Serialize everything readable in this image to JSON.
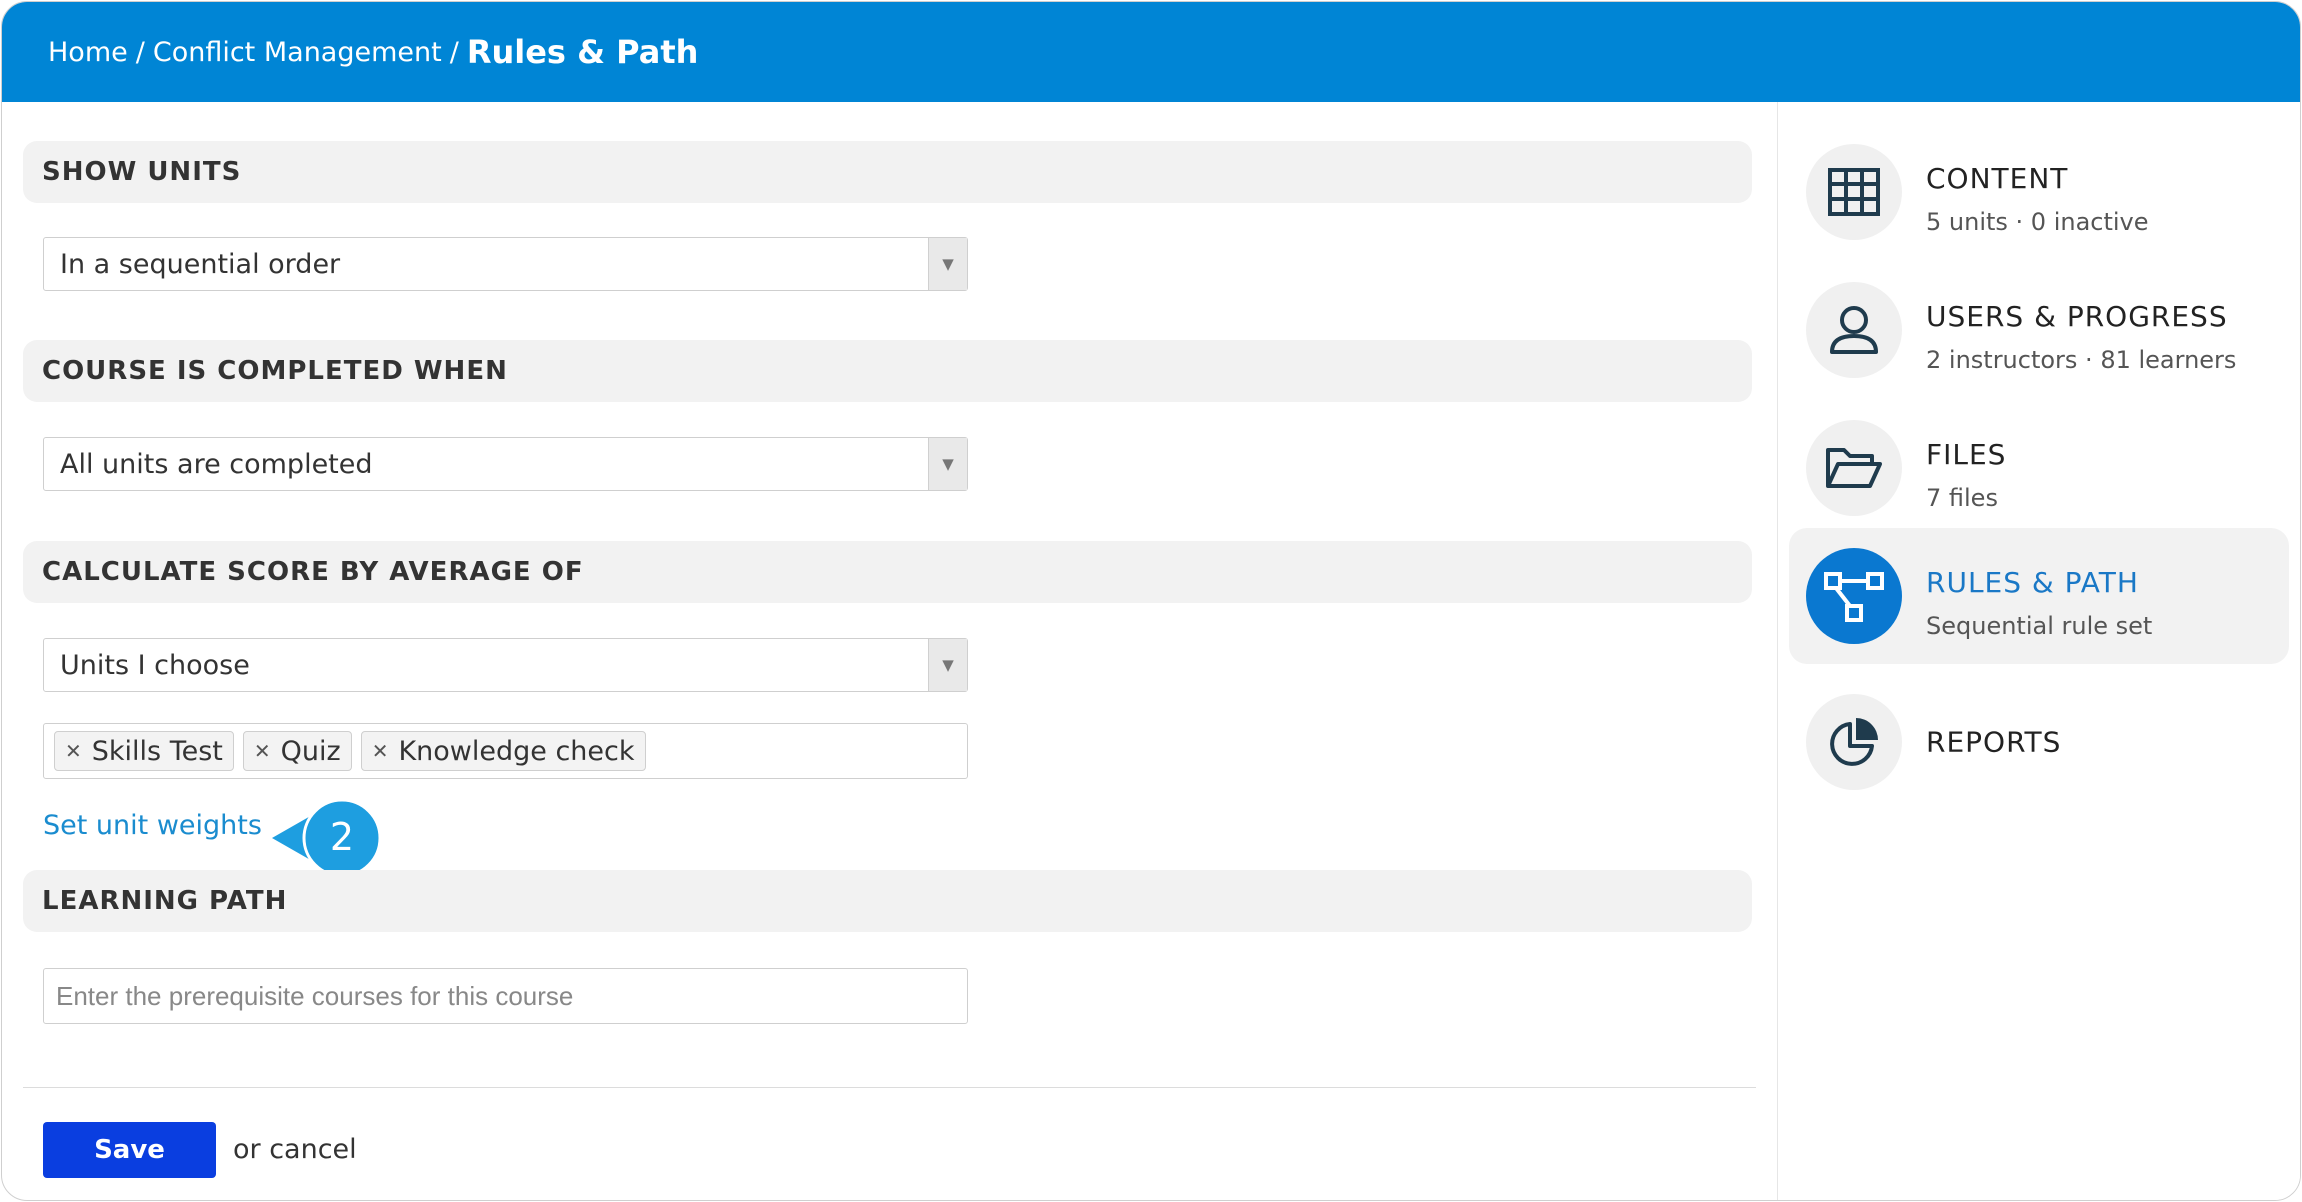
{
  "breadcrumb": {
    "home": "Home",
    "separator": "/",
    "course": "Conflict Management",
    "current": "Rules & Path"
  },
  "sections": {
    "show_units": {
      "title": "SHOW UNITS",
      "selected": "In a sequential order"
    },
    "completion": {
      "title": "COURSE IS COMPLETED WHEN",
      "selected": "All units are completed"
    },
    "score": {
      "title": "CALCULATE SCORE BY AVERAGE OF",
      "selected": "Units I choose",
      "tags": [
        "Skills Test",
        "Quiz",
        "Knowledge check"
      ],
      "link": "Set unit weights",
      "callout_number": "2"
    },
    "learning_path": {
      "title": "LEARNING PATH",
      "placeholder": "Enter the prerequisite courses for this course"
    }
  },
  "actions": {
    "save": "Save",
    "cancel": "or cancel"
  },
  "sidebar": {
    "items": [
      {
        "title": "CONTENT",
        "subtitle": "5 units · 0 inactive",
        "icon": "grid-icon"
      },
      {
        "title": "USERS & PROGRESS",
        "subtitle": "2 instructors · 81 learners",
        "icon": "user-icon"
      },
      {
        "title": "FILES",
        "subtitle": "7 files",
        "icon": "folder-icon"
      },
      {
        "title": "RULES & PATH",
        "subtitle": "Sequential rule set",
        "icon": "flow-icon",
        "active": true
      },
      {
        "title": "REPORTS",
        "subtitle": "",
        "icon": "pie-chart-icon"
      }
    ]
  },
  "colors": {
    "header": "#0085d5",
    "save_button": "#0a3ee0",
    "link": "#1a8ccf",
    "active_nav": "#1a78c6",
    "callout": "#1e9ee0"
  }
}
